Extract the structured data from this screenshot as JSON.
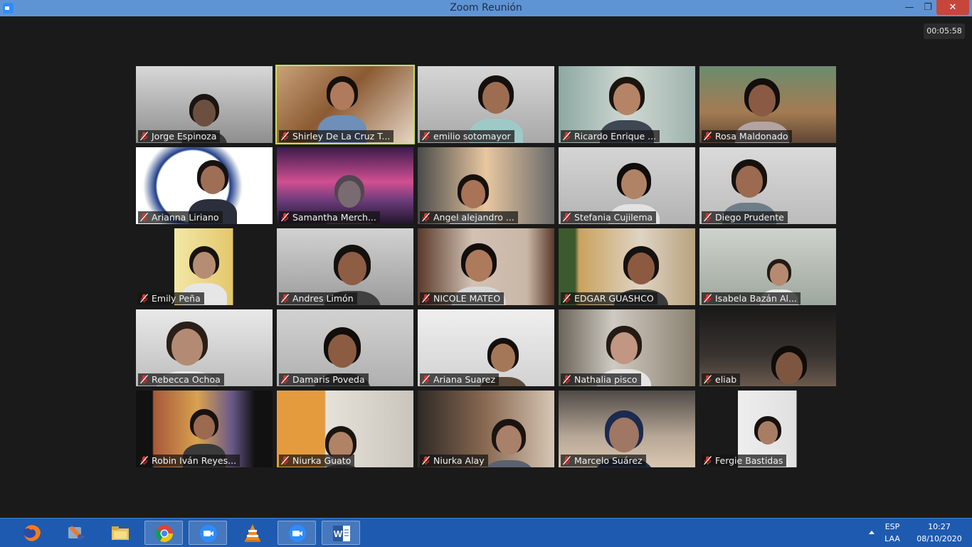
{
  "window": {
    "title": "Zoom Reunión",
    "minimize_glyph": "—",
    "maximize_glyph": "❐",
    "close_glyph": "✕"
  },
  "meeting": {
    "timer": "00:05:58",
    "active_speaker": "Shirley De La Cruz T...",
    "participants": [
      {
        "name": "Jorge Espinoza"
      },
      {
        "name": "Shirley De La Cruz T..."
      },
      {
        "name": "emilio sotomayor"
      },
      {
        "name": "Ricardo Enrique ..."
      },
      {
        "name": "Rosa Maldonado"
      },
      {
        "name": "Arianna Liriano"
      },
      {
        "name": "Samantha Merch..."
      },
      {
        "name": "Angel alejandro ..."
      },
      {
        "name": "Stefania Cujilema"
      },
      {
        "name": "Diego Prudente"
      },
      {
        "name": "Emily  Peña"
      },
      {
        "name": "Andres Limón"
      },
      {
        "name": "NICOLE MATEO"
      },
      {
        "name": "EDGAR GUASHCO"
      },
      {
        "name": "Isabela Bazán Al..."
      },
      {
        "name": "Rebecca Ochoa"
      },
      {
        "name": "Damaris Poveda"
      },
      {
        "name": "Ariana Suarez"
      },
      {
        "name": "Nathalia pisco"
      },
      {
        "name": "eliab"
      },
      {
        "name": "Robin Iván Reyes..."
      },
      {
        "name": "Niurka Guato"
      },
      {
        "name": "Niurka Alay"
      },
      {
        "name": "Marcelo Suárez"
      },
      {
        "name": "Fergie Bastidas"
      }
    ]
  },
  "taskbar": {
    "apps": [
      {
        "icon": "firefox-icon"
      },
      {
        "icon": "media-player-icon"
      },
      {
        "icon": "file-explorer-icon"
      },
      {
        "icon": "chrome-icon"
      },
      {
        "icon": "zoom-icon"
      },
      {
        "icon": "vlc-icon"
      },
      {
        "icon": "zoom-icon"
      },
      {
        "icon": "word-icon"
      }
    ],
    "language_top": "ESP",
    "language_bottom": "LAA",
    "time": "10:27",
    "date": "08/10/2020"
  },
  "colors": {
    "titlebar": "#5f94d4",
    "active_speaker_border": "#c9e04a",
    "muted_mic": "#e0322c",
    "taskbar": "#1e5bb0"
  }
}
